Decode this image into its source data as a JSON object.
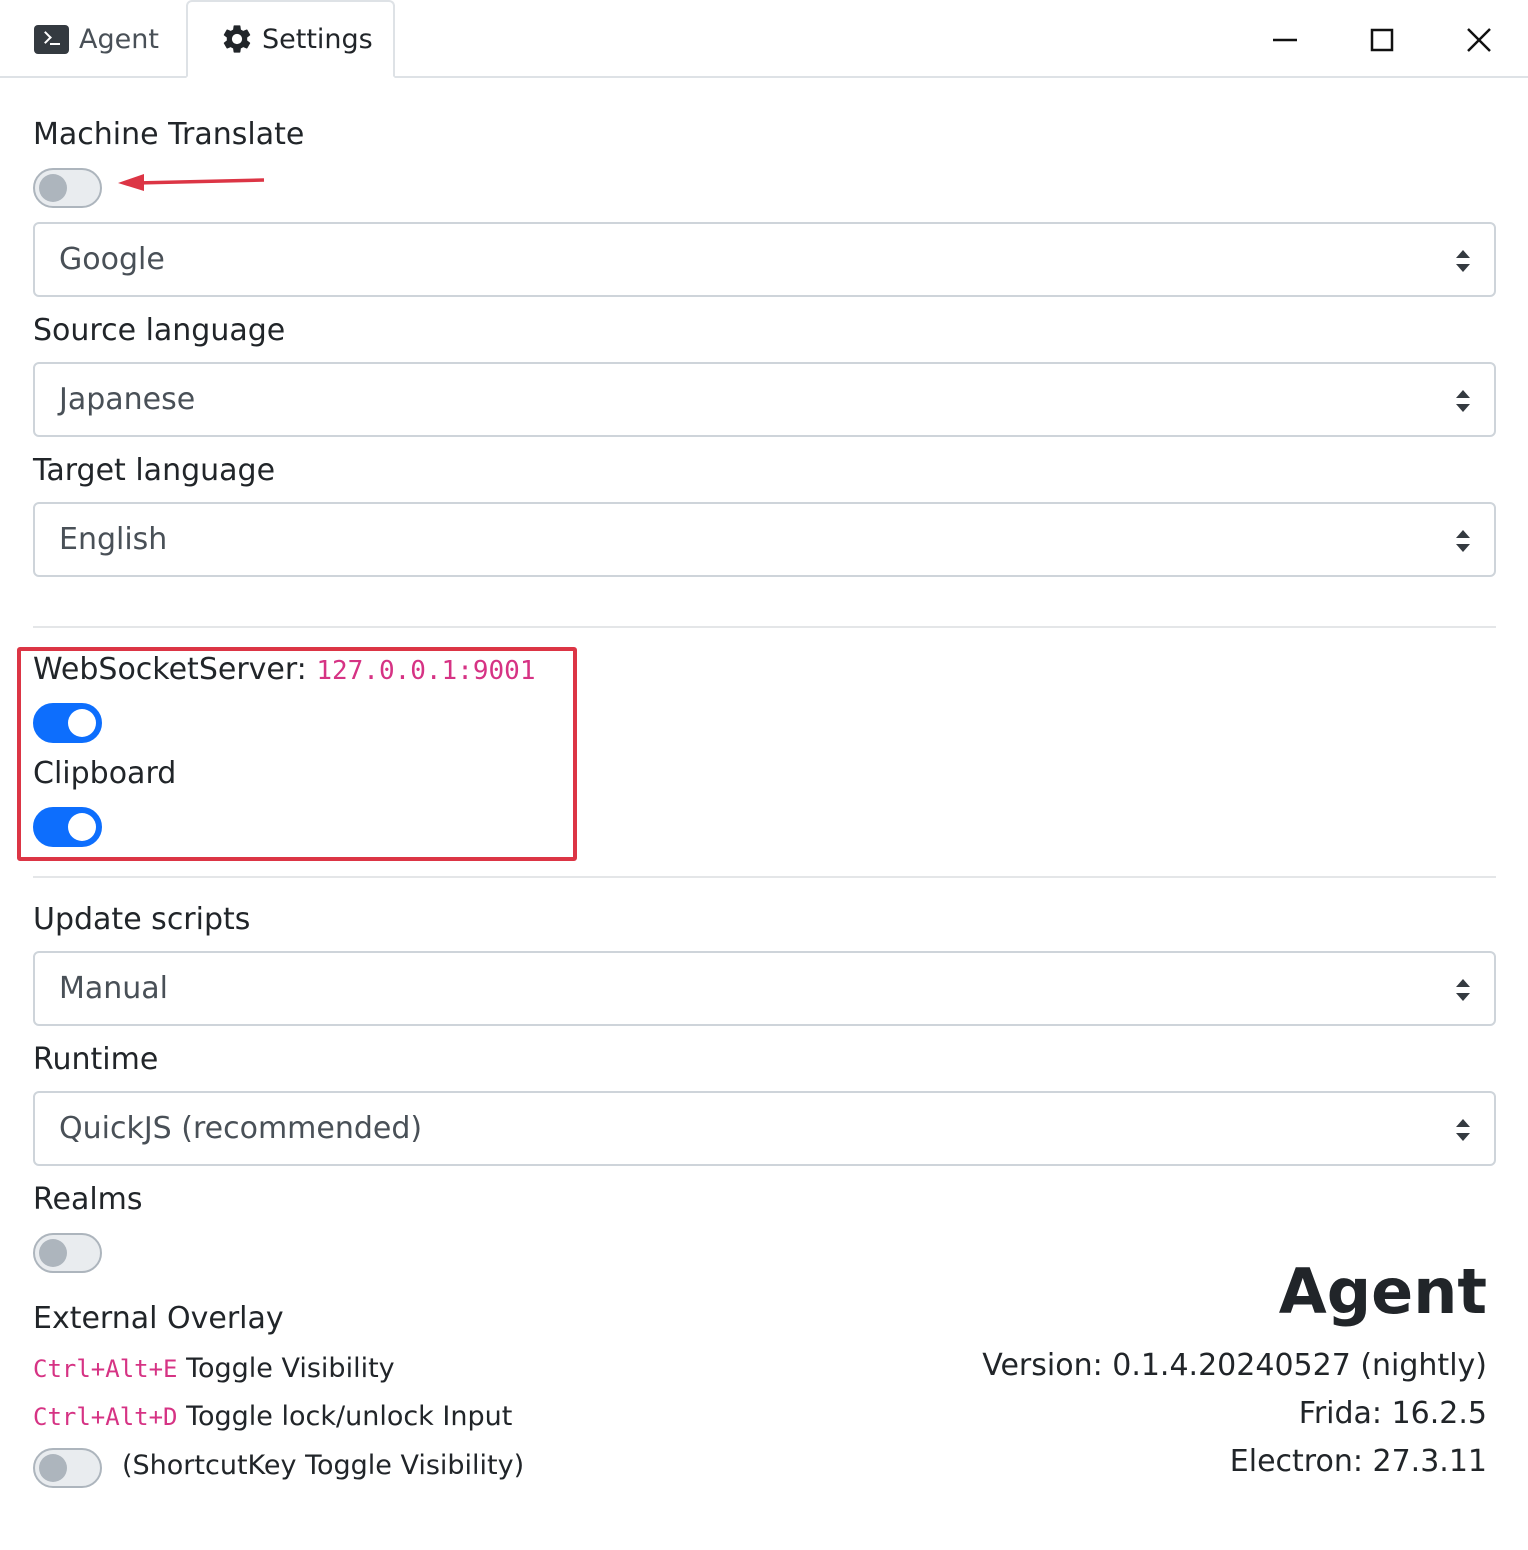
{
  "tabs": {
    "agent": "Agent",
    "settings": "Settings"
  },
  "machine_translate": {
    "label": "Machine Translate",
    "enabled": false,
    "provider": "Google"
  },
  "source_language": {
    "label": "Source language",
    "value": "Japanese"
  },
  "target_language": {
    "label": "Target language",
    "value": "English"
  },
  "websocket": {
    "label": "WebSocketServer:",
    "address": "127.0.0.1:9001",
    "enabled": true
  },
  "clipboard": {
    "label": "Clipboard",
    "enabled": true
  },
  "update_scripts": {
    "label": "Update scripts",
    "value": "Manual"
  },
  "runtime": {
    "label": "Runtime",
    "value": "QuickJS (recommended)"
  },
  "realms": {
    "label": "Realms",
    "enabled": false
  },
  "external_overlay": {
    "label": "External Overlay",
    "shortcut1_key": "Ctrl+Alt+E",
    "shortcut1_text": "Toggle Visibility",
    "shortcut2_key": "Ctrl+Alt+D",
    "shortcut2_text": "Toggle lock/unlock Input",
    "shortcut_toggle_label": "(ShortcutKey Toggle Visibility)",
    "shortcut_toggle_enabled": false
  },
  "about": {
    "title": "Agent",
    "version": "Version: 0.1.4.20240527 (nightly)",
    "frida": "Frida: 16.2.5",
    "electron": "Electron: 27.3.11"
  },
  "colors": {
    "accent": "#0d6efd",
    "annotation": "#dc3545",
    "code": "#d63384"
  },
  "icons": {
    "agent_tab": "terminal-icon",
    "settings_tab": "gear-icon",
    "window_minimize": "minimize-icon",
    "window_maximize": "maximize-icon",
    "window_close": "close-icon",
    "select_caret": "sort-caret-icon"
  }
}
